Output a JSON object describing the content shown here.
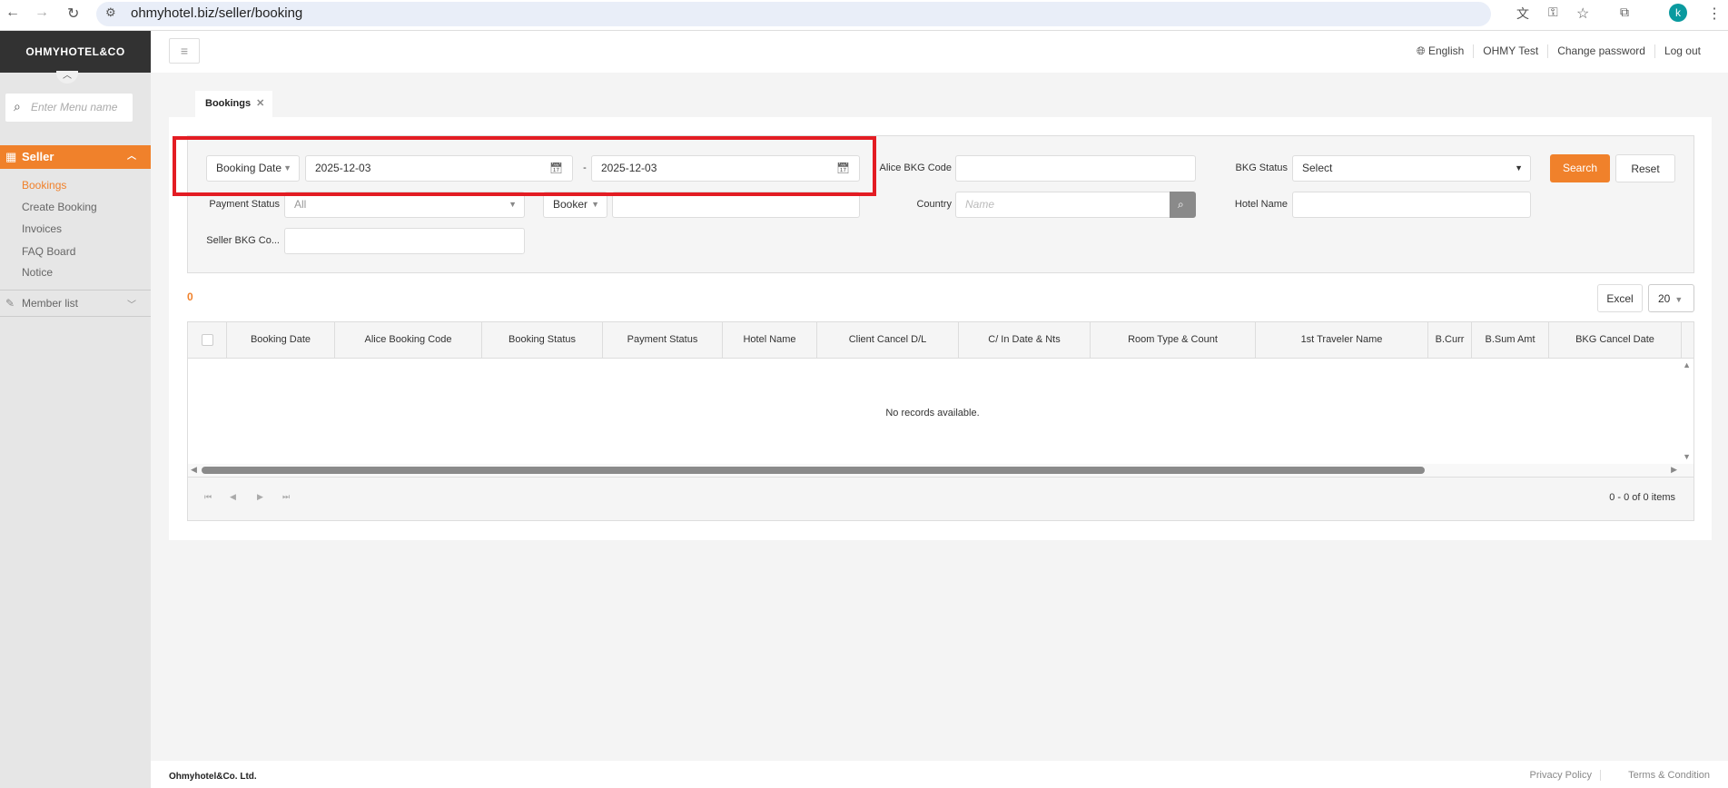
{
  "browser": {
    "url": "ohmyhotel.biz/seller/booking",
    "avatar": "k"
  },
  "sidebar": {
    "logo": "OHMYHOTEL&CO",
    "search_placeholder": "Enter Menu name",
    "section": "Seller",
    "items": [
      {
        "label": "Bookings",
        "active": true
      },
      {
        "label": "Create Booking"
      },
      {
        "label": "Invoices"
      },
      {
        "label": "FAQ Board"
      },
      {
        "label": "Notice"
      }
    ],
    "member_list": "Member list"
  },
  "header": {
    "language": "English",
    "user": "OHMY Test",
    "change_password": "Change password",
    "logout": "Log out"
  },
  "tab": {
    "label": "Bookings"
  },
  "filters": {
    "date_type": "Booking Date",
    "date_from": "2025-12-03",
    "date_sep": "-",
    "date_to": "2025-12-03",
    "alice_code_label": "Alice BKG Code",
    "alice_code_value": "",
    "bkg_status_label": "BKG Status",
    "bkg_status_value": "Select",
    "payment_status_label": "Payment Status",
    "payment_status_value": "All",
    "booker_label": "Booker",
    "booker_value": "",
    "country_label": "Country",
    "country_placeholder": "Name",
    "hotel_name_label": "Hotel Name",
    "hotel_name_value": "",
    "seller_code_label": "Seller BKG Co...",
    "seller_code_value": "",
    "search": "Search",
    "reset": "Reset"
  },
  "results": {
    "count": "0",
    "excel": "Excel",
    "page_size": "20",
    "columns": [
      "Booking Date",
      "Alice Booking Code",
      "Booking Status",
      "Payment Status",
      "Hotel Name",
      "Client Cancel D/L",
      "C/ In Date & Nts",
      "Room Type & Count",
      "1st Traveler Name",
      "B.Curr",
      "B.Sum Amt",
      "BKG Cancel Date"
    ],
    "empty": "No records available.",
    "pager_info": "0 - 0 of 0 items"
  },
  "colors": {
    "accent": "#f0812b",
    "highlight": "#e31c23"
  },
  "footer": {
    "company": "Ohmyhotel&Co. Ltd.",
    "privacy": "Privacy Policy",
    "terms": "Terms & Condition"
  }
}
